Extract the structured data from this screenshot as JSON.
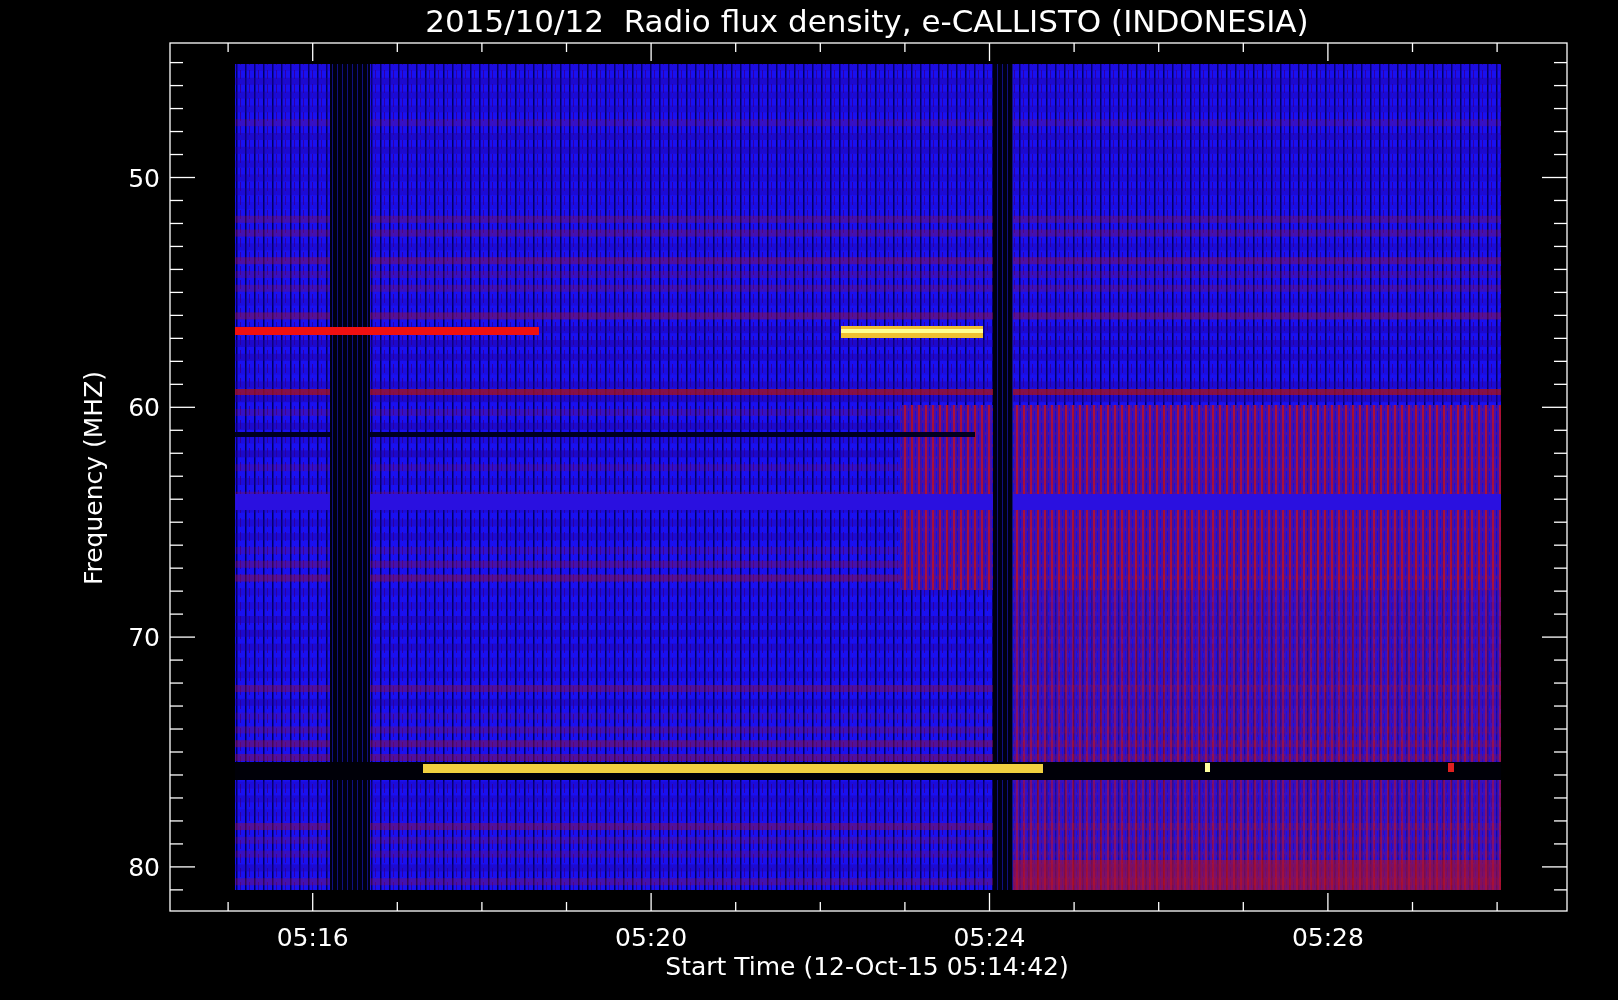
{
  "plot": {
    "title": "2015/10/12  Radio flux density, e-CALLISTO (INDONESIA)",
    "y_axis": {
      "label": "Frequency (MHZ)",
      "ticks": [
        "50",
        "60",
        "70",
        "80"
      ]
    },
    "x_axis": {
      "label": "Start Time (12-Oct-15 05:14:42)",
      "ticks": [
        "05:16",
        "05:20",
        "05:24",
        "05:28"
      ]
    }
  }
}
